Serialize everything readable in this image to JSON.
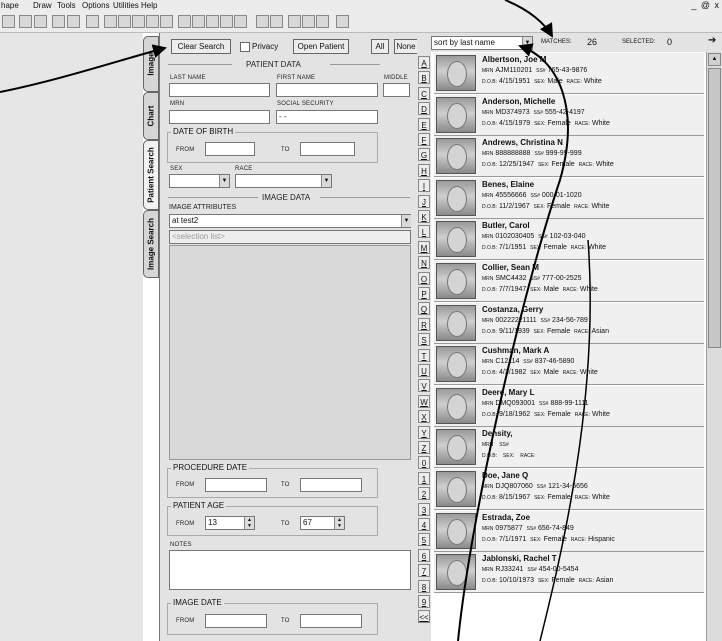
{
  "menu": {
    "items": [
      "hape",
      "Draw",
      "Tools",
      "Options",
      "Utilities",
      "Help"
    ],
    "window_controls": "_ @ x"
  },
  "tabs": [
    "Image",
    "Chart",
    "Patient Search",
    "Image Search"
  ],
  "search_form": {
    "clear_search": "Clear Search",
    "privacy": "Privacy",
    "open_patient": "Open Patient",
    "all": "All",
    "none": "None",
    "patient_data_title": "PATIENT DATA",
    "last_name_label": "LAST NAME",
    "first_name_label": "FIRST NAME",
    "middle_label": "MIDDLE",
    "mrn_label": "MRN",
    "ssn_label": "SOCIAL SECURITY",
    "ssn_value": "- -",
    "dob_label": "DATE OF BIRTH",
    "from_label": "FROM",
    "to_label": "TO",
    "sex_label": "SEX",
    "race_label": "RACE",
    "image_data_title": "IMAGE DATA",
    "image_attributes_label": "IMAGE ATTRIBUTES",
    "image_attributes_value": "at test2",
    "selection_list_placeholder": "<selection list>",
    "procedure_date_label": "PROCEDURE DATE",
    "patient_age_label": "PATIENT AGE",
    "age_from": "13",
    "age_to": "67",
    "notes_label": "NOTES",
    "image_date_label": "IMAGE DATE"
  },
  "list_header": {
    "sort": "sort by last name",
    "matches_label": "MATCHES:",
    "matches": "26",
    "selected_label": "SELECTED:",
    "selected": "0"
  },
  "letters": [
    "A",
    "B",
    "C",
    "D",
    "E",
    "F",
    "G",
    "H",
    "I",
    "J",
    "K",
    "L",
    "M",
    "N",
    "O",
    "P",
    "Q",
    "R",
    "S",
    "T",
    "U",
    "V",
    "W",
    "X",
    "Y",
    "Z",
    "0",
    "1",
    "2",
    "3",
    "4",
    "5",
    "6",
    "7",
    "8",
    "9",
    "<<"
  ],
  "field_labels": {
    "mrn": "MRN",
    "ss": "SS#",
    "dob": "D.O.B:",
    "sex": "SEX:",
    "race": "RACE:"
  },
  "patients": [
    {
      "name": "Albertson, Joe M",
      "mrn": "AJM110201",
      "ss": "765-43-9876",
      "dob": "4/15/1951",
      "sex": "Male",
      "race": "White"
    },
    {
      "name": "Anderson, Michelle",
      "mrn": "MD374973",
      "ss": "555-42-4197",
      "dob": "4/15/1979",
      "sex": "Female",
      "race": "White"
    },
    {
      "name": "Andrews, Christina N",
      "mrn": "888888888",
      "ss": "999-99-999",
      "dob": "12/25/1947",
      "sex": "Female",
      "race": "White"
    },
    {
      "name": "Benes, Elaine",
      "mrn": "45556666",
      "ss": "000-01-1020",
      "dob": "11/2/1967",
      "sex": "Female",
      "race": "White"
    },
    {
      "name": "Butler, Carol",
      "mrn": "0102030405",
      "ss": "102-03-040",
      "dob": "7/1/1951",
      "sex": "Female",
      "race": "White"
    },
    {
      "name": "Collier, Sean M",
      "mrn": "SMC4432",
      "ss": "777-00-2525",
      "dob": "7/7/1947",
      "sex": "Male",
      "race": "White"
    },
    {
      "name": "Costanza, Gerry",
      "mrn": "00222221111",
      "ss": "234-56-789",
      "dob": "9/11/1939",
      "sex": "Female",
      "race": "Asian"
    },
    {
      "name": "Cushman, Mark A",
      "mrn": "C12114",
      "ss": "837-46-5890",
      "dob": "4/3/1982",
      "sex": "Male",
      "race": "White"
    },
    {
      "name": "Deere, Mary L",
      "mrn": "DMQ093001",
      "ss": "888-99-1111",
      "dob": "9/18/1962",
      "sex": "Female",
      "race": "White"
    },
    {
      "name": "Density,",
      "mrn": "",
      "ss": "",
      "dob": "",
      "sex": "",
      "race": ""
    },
    {
      "name": "Doe, Jane Q",
      "mrn": "DJQ807060",
      "ss": "121-34-5656",
      "dob": "8/15/1967",
      "sex": "Female",
      "race": "White"
    },
    {
      "name": "Estrada, Zoe",
      "mrn": "0975877",
      "ss": "656-74-849",
      "dob": "7/1/1971",
      "sex": "Female",
      "race": "Hispanic"
    },
    {
      "name": "Jablonski, Rachel T",
      "mrn": "RJ33241",
      "ss": "454-00-5454",
      "dob": "10/10/1973",
      "sex": "Female",
      "race": "Asian"
    }
  ]
}
